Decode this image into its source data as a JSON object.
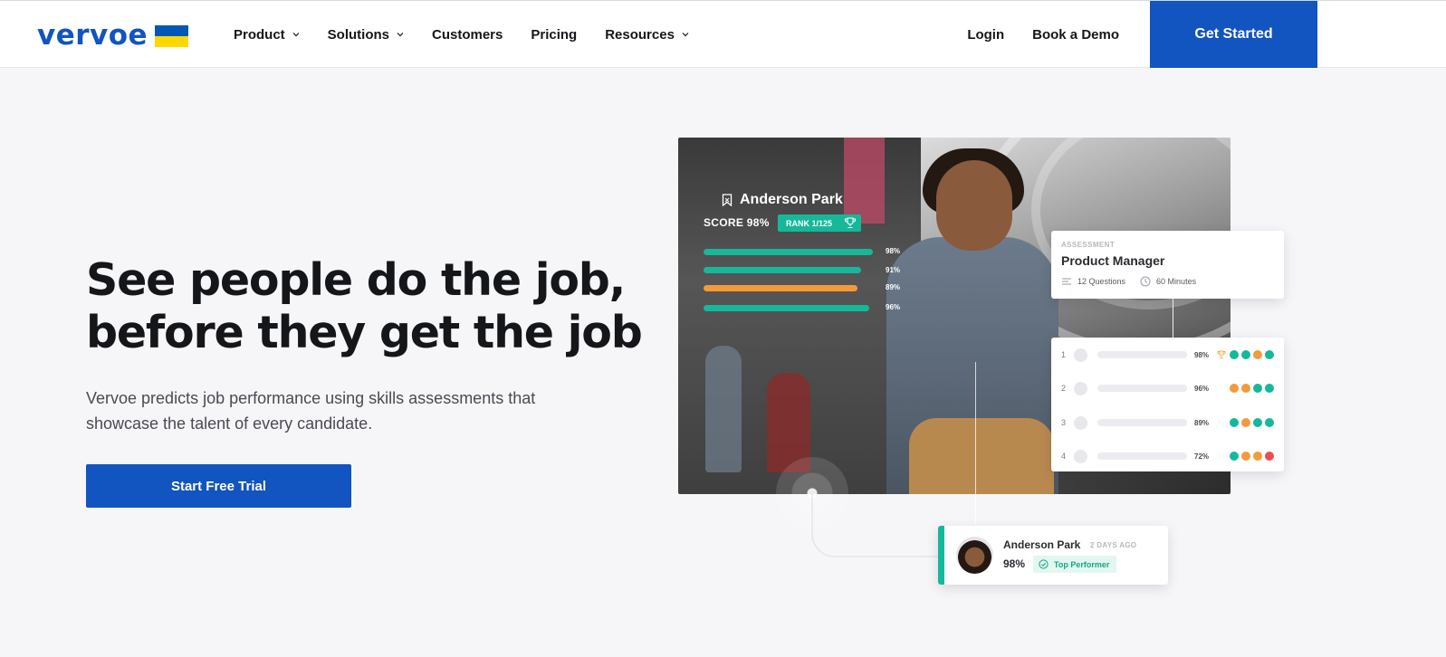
{
  "nav": {
    "logo": "vervoe",
    "flag_colors": {
      "top": "#0057b7",
      "bottom": "#ffd700"
    },
    "items": [
      {
        "label": "Product",
        "has_dropdown": true
      },
      {
        "label": "Solutions",
        "has_dropdown": true
      },
      {
        "label": "Customers",
        "has_dropdown": false
      },
      {
        "label": "Pricing",
        "has_dropdown": false
      },
      {
        "label": "Resources",
        "has_dropdown": true
      }
    ],
    "login": "Login",
    "demo": "Book a Demo",
    "get_started": "Get Started"
  },
  "hero": {
    "title_line1": "See people do the job,",
    "title_line2": "before they get the job",
    "subtitle_line1": "Vervoe predicts job performance using skills assessments that",
    "subtitle_line2": "showcase the talent of every candidate.",
    "cta": "Start Free Trial"
  },
  "candidate": {
    "name": "Anderson Park",
    "score_label": "SCORE 98%",
    "rank": "RANK 1/125",
    "skills": [
      {
        "pct_label": "98%",
        "value": 0.98,
        "color": "#16b89a"
      },
      {
        "pct_label": "91%",
        "value": 0.91,
        "color": "#16b89a"
      },
      {
        "pct_label": "89%",
        "value": 0.89,
        "color": "#f59a3a"
      },
      {
        "pct_label": "96%",
        "value": 0.96,
        "color": "#16b89a"
      }
    ]
  },
  "assessment": {
    "label": "ASSESSMENT",
    "title": "Product Manager",
    "questions": "12 Questions",
    "duration": "60 Minutes"
  },
  "ranking": [
    {
      "rank": "1",
      "pct": "98%",
      "trophy": true,
      "dots": [
        "#16b89a",
        "#16b89a",
        "#f59a3a",
        "#16b89a"
      ]
    },
    {
      "rank": "2",
      "pct": "96%",
      "trophy": false,
      "dots": [
        "#f59a3a",
        "#f59a3a",
        "#16b89a",
        "#16b89a"
      ]
    },
    {
      "rank": "3",
      "pct": "89%",
      "trophy": false,
      "dots": [
        "#16b89a",
        "#f59a3a",
        "#16b89a",
        "#16b89a"
      ]
    },
    {
      "rank": "4",
      "pct": "72%",
      "trophy": false,
      "dots": [
        "#16b89a",
        "#f59a3a",
        "#f59a3a",
        "#ef4b55"
      ]
    }
  ],
  "top_performer": {
    "name": "Anderson Park",
    "ago": "2 DAYS AGO",
    "pct": "98%",
    "badge": "Top Performer"
  },
  "colors": {
    "brand_blue": "#1254c0",
    "teal": "#16b89a",
    "orange": "#f59a3a",
    "red": "#ef4b55"
  }
}
